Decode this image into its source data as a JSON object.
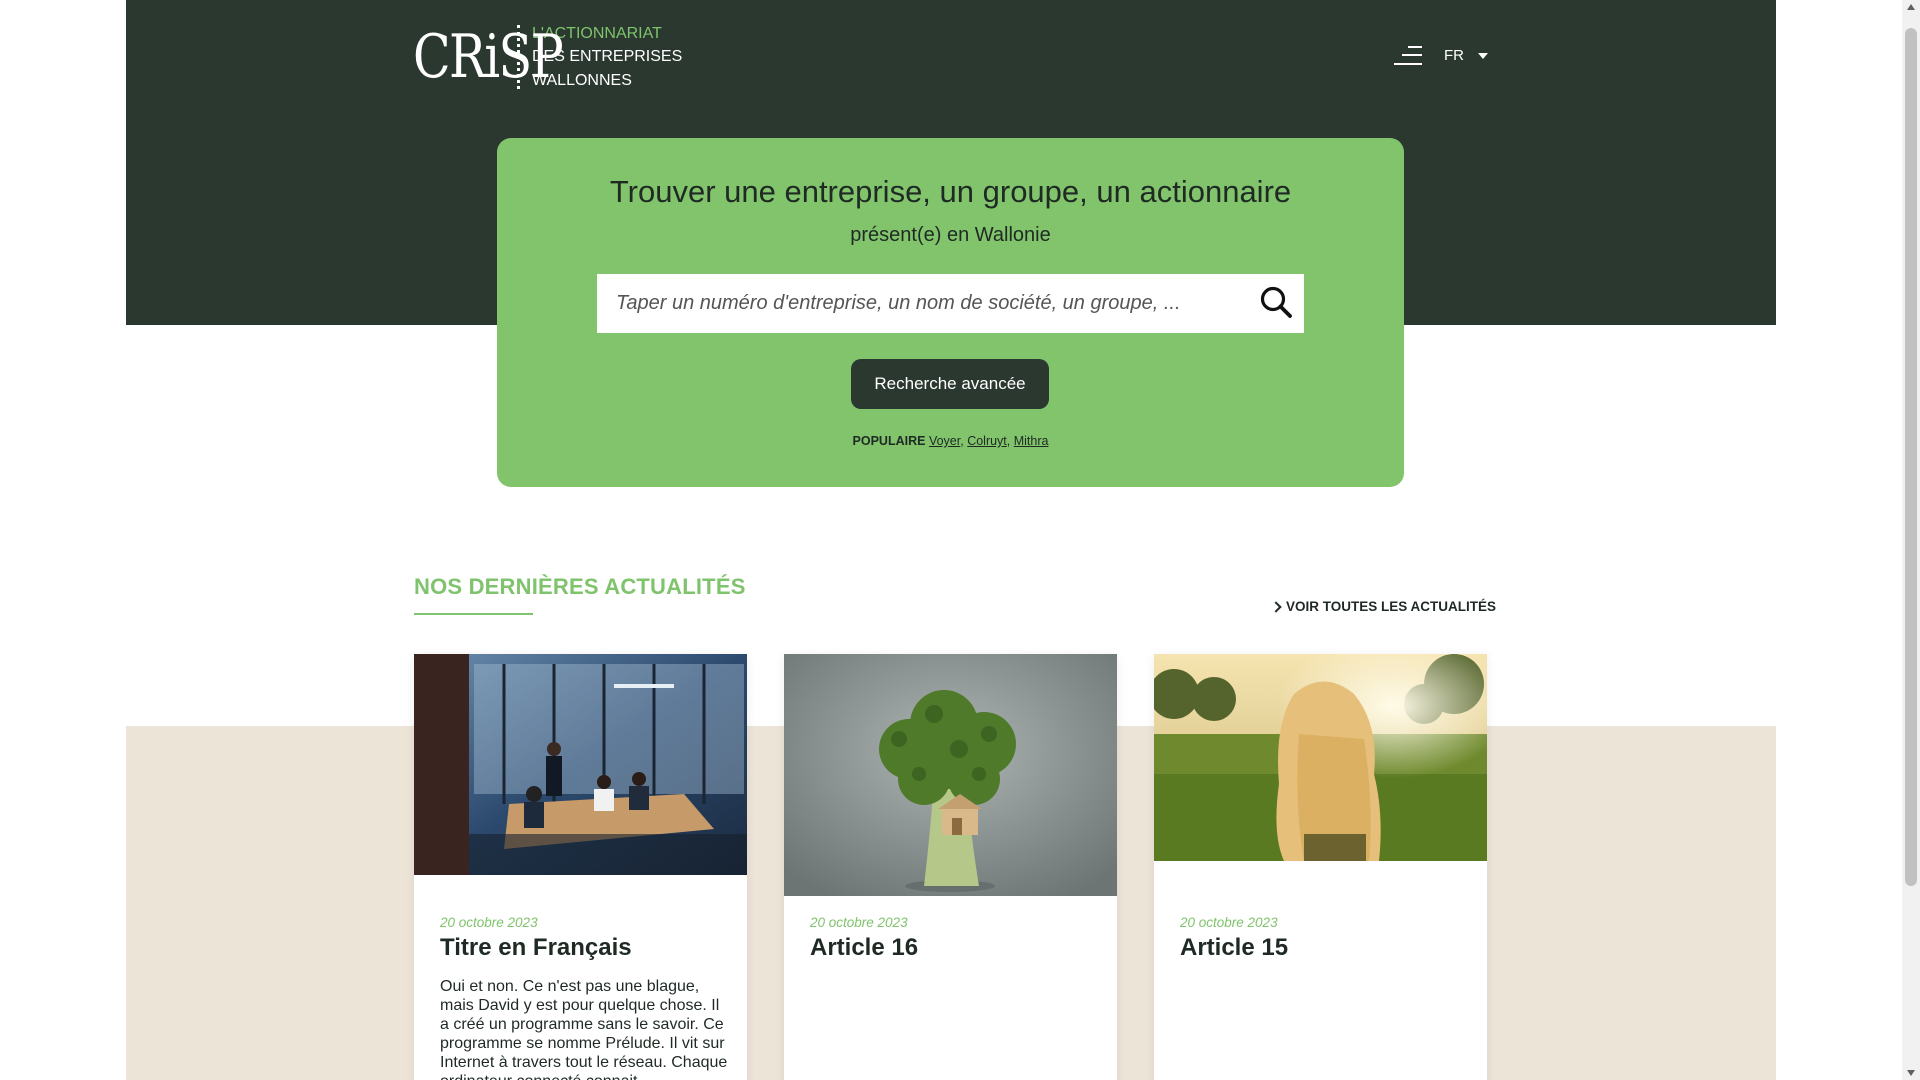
{
  "header": {
    "logo_mark": "CRiSP",
    "logo_lines": [
      "L'ACTIONNARIAT",
      "DES ENTREPRISES",
      "WALLONNES"
    ],
    "language": "FR"
  },
  "search": {
    "title": "Trouver une entreprise, un groupe, un actionnaire",
    "subtitle": "présent(e) en Wallonie",
    "placeholder": "Taper un numéro d'entreprise, un nom de société, un groupe, ...",
    "advanced_label": "Recherche avancée",
    "popular_label": "POPULAIRE",
    "popular_links": [
      "Voyer",
      "Colruyt",
      "Mithra"
    ]
  },
  "news": {
    "heading": "NOS DERNIÈRES ACTUALITÉS",
    "see_all": "VOIR TOUTES LES ACTUALITÉS",
    "cards": [
      {
        "date": "20 octobre 2023",
        "title": "Titre en Français",
        "excerpt": "Oui et non. Ce n'est pas une blague, mais David y est pour quelque chose. Il a créé un programme sans le savoir. Ce programme se nomme Prélude. Il vit sur Internet à travers tout le réseau. Chaque ordinateur connecté connait"
      },
      {
        "date": "20 octobre 2023",
        "title": "Article 16",
        "excerpt": ""
      },
      {
        "date": "20 octobre 2023",
        "title": "Article 15",
        "excerpt": ""
      }
    ]
  },
  "colors": {
    "dark_green": "#2b3830",
    "accent_green": "#81c46c",
    "beige": "#ede4d8"
  },
  "icons": {
    "menu": "menu-icon",
    "search": "search-icon",
    "caret": "chevron-down-icon",
    "see_all": "chevron-right-icon"
  }
}
